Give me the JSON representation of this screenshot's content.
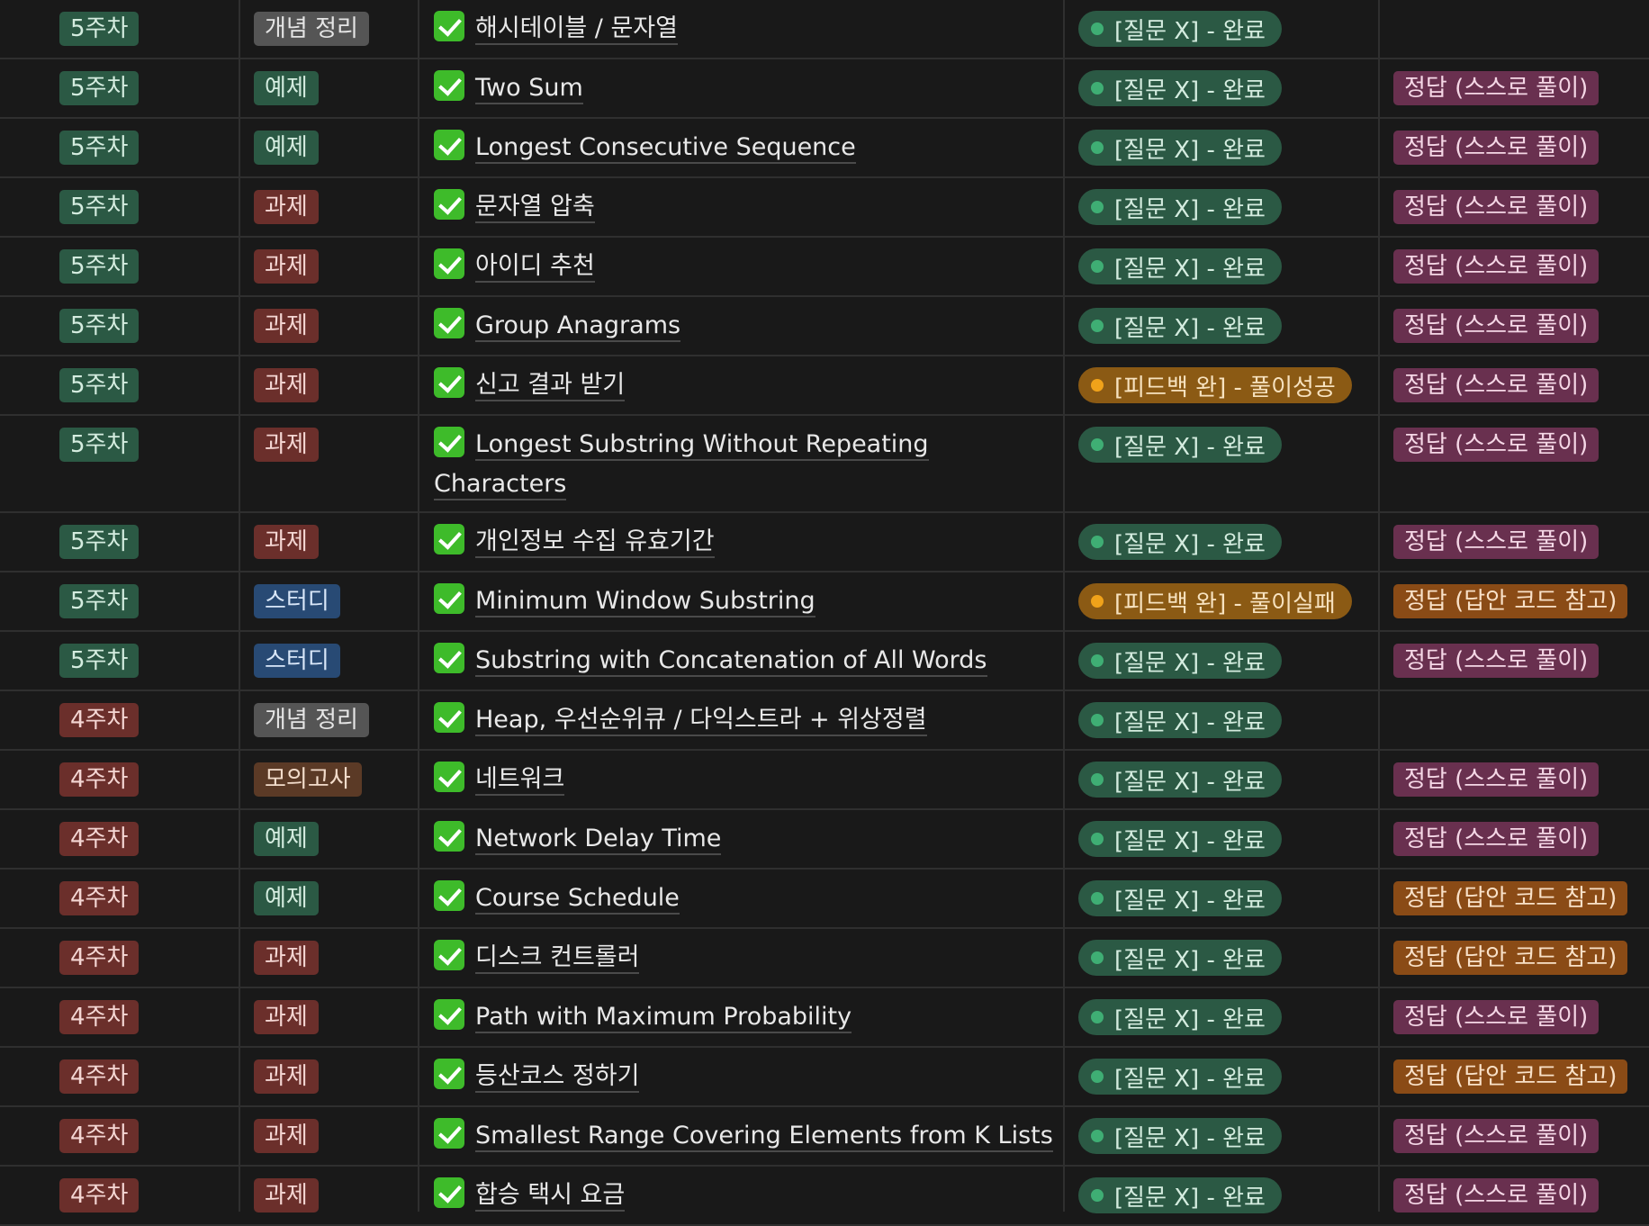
{
  "colors": {
    "background": "#191919",
    "grid": "#2f2f2f",
    "week_green": "#2b5944",
    "week_red": "#6b2f2b",
    "status_green": "#2b5944",
    "status_orange": "#8b5a14",
    "answer_pink": "#69304f",
    "answer_orange": "#8a4b16"
  },
  "icons": {
    "done": "check-mark-button-icon",
    "status": "status-dot-icon"
  },
  "rows": [
    {
      "week": "5주차",
      "week_color": "green",
      "category": "개념 정리",
      "category_color": "gray",
      "title": "해시테이블 / 문자열",
      "status": "[질문 X] - 완료",
      "status_color": "green",
      "answer": "",
      "answer_color": ""
    },
    {
      "week": "5주차",
      "week_color": "green",
      "category": "예제",
      "category_color": "green",
      "title": "Two Sum",
      "status": "[질문 X] - 완료",
      "status_color": "green",
      "answer": "정답 (스스로 풀이)",
      "answer_color": "pink"
    },
    {
      "week": "5주차",
      "week_color": "green",
      "category": "예제",
      "category_color": "green",
      "title": "Longest Consecutive Sequence",
      "status": "[질문 X] - 완료",
      "status_color": "green",
      "answer": "정답 (스스로 풀이)",
      "answer_color": "pink"
    },
    {
      "week": "5주차",
      "week_color": "green",
      "category": "과제",
      "category_color": "red",
      "title": "문자열 압축",
      "status": "[질문 X] - 완료",
      "status_color": "green",
      "answer": "정답 (스스로 풀이)",
      "answer_color": "pink"
    },
    {
      "week": "5주차",
      "week_color": "green",
      "category": "과제",
      "category_color": "red",
      "title": "아이디 추천",
      "status": "[질문 X] - 완료",
      "status_color": "green",
      "answer": "정답 (스스로 풀이)",
      "answer_color": "pink"
    },
    {
      "week": "5주차",
      "week_color": "green",
      "category": "과제",
      "category_color": "red",
      "title": "Group Anagrams",
      "status": "[질문 X] - 완료",
      "status_color": "green",
      "answer": "정답 (스스로 풀이)",
      "answer_color": "pink"
    },
    {
      "week": "5주차",
      "week_color": "green",
      "category": "과제",
      "category_color": "red",
      "title": "신고 결과 받기",
      "status": "[피드백 완] - 풀이성공",
      "status_color": "orange",
      "answer": "정답 (스스로 풀이)",
      "answer_color": "pink"
    },
    {
      "week": "5주차",
      "week_color": "green",
      "category": "과제",
      "category_color": "red",
      "title": "Longest Substring Without Repeating Characters",
      "status": "[질문 X] - 완료",
      "status_color": "green",
      "answer": "정답 (스스로 풀이)",
      "answer_color": "pink"
    },
    {
      "week": "5주차",
      "week_color": "green",
      "category": "과제",
      "category_color": "red",
      "title": "개인정보 수집 유효기간",
      "status": "[질문 X] - 완료",
      "status_color": "green",
      "answer": "정답 (스스로 풀이)",
      "answer_color": "pink"
    },
    {
      "week": "5주차",
      "week_color": "green",
      "category": "스터디",
      "category_color": "blue",
      "title": "Minimum Window Substring",
      "status": "[피드백 완] - 풀이실패",
      "status_color": "orange",
      "answer": "정답 (답안 코드 참고)",
      "answer_color": "orange"
    },
    {
      "week": "5주차",
      "week_color": "green",
      "category": "스터디",
      "category_color": "blue",
      "title": "Substring with Concatenation of All Words",
      "status": "[질문 X] - 완료",
      "status_color": "green",
      "answer": "정답 (스스로 풀이)",
      "answer_color": "pink"
    },
    {
      "week": "4주차",
      "week_color": "red",
      "category": "개념 정리",
      "category_color": "gray",
      "title": "Heap, 우선순위큐 / 다익스트라 + 위상정렬",
      "status": "[질문 X] - 완료",
      "status_color": "green",
      "answer": "",
      "answer_color": ""
    },
    {
      "week": "4주차",
      "week_color": "red",
      "category": "모의고사",
      "category_color": "brown",
      "title": "네트워크",
      "status": "[질문 X] - 완료",
      "status_color": "green",
      "answer": "정답 (스스로 풀이)",
      "answer_color": "pink"
    },
    {
      "week": "4주차",
      "week_color": "red",
      "category": "예제",
      "category_color": "green",
      "title": "Network Delay Time",
      "status": "[질문 X] - 완료",
      "status_color": "green",
      "answer": "정답 (스스로 풀이)",
      "answer_color": "pink"
    },
    {
      "week": "4주차",
      "week_color": "red",
      "category": "예제",
      "category_color": "green",
      "title": "Course Schedule",
      "status": "[질문 X] - 완료",
      "status_color": "green",
      "answer": "정답 (답안 코드 참고)",
      "answer_color": "orange"
    },
    {
      "week": "4주차",
      "week_color": "red",
      "category": "과제",
      "category_color": "red",
      "title": "디스크 컨트롤러",
      "status": "[질문 X] - 완료",
      "status_color": "green",
      "answer": "정답 (답안 코드 참고)",
      "answer_color": "orange"
    },
    {
      "week": "4주차",
      "week_color": "red",
      "category": "과제",
      "category_color": "red",
      "title": "Path with Maximum Probability",
      "status": "[질문 X] - 완료",
      "status_color": "green",
      "answer": "정답 (스스로 풀이)",
      "answer_color": "pink"
    },
    {
      "week": "4주차",
      "week_color": "red",
      "category": "과제",
      "category_color": "red",
      "title": "등산코스 정하기",
      "status": "[질문 X] - 완료",
      "status_color": "green",
      "answer": "정답 (답안 코드 참고)",
      "answer_color": "orange"
    },
    {
      "week": "4주차",
      "week_color": "red",
      "category": "과제",
      "category_color": "red",
      "title": "Smallest Range Covering Elements from K Lists",
      "status": "[질문 X] - 완료",
      "status_color": "green",
      "answer": "정답 (스스로 풀이)",
      "answer_color": "pink"
    },
    {
      "week": "4주차",
      "week_color": "red",
      "category": "과제",
      "category_color": "red",
      "title": "합승 택시 요금",
      "status": "[질문 X] - 완료",
      "status_color": "green",
      "answer": "정답 (스스로 풀이)",
      "answer_color": "pink"
    }
  ]
}
